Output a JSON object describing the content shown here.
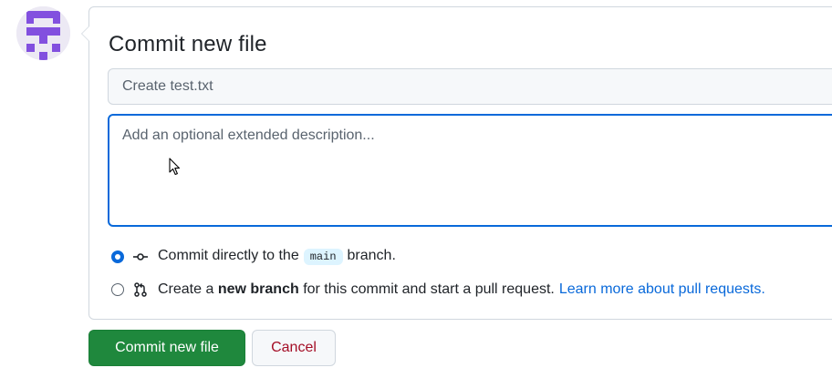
{
  "form": {
    "title": "Commit new file",
    "summary_value": "",
    "summary_placeholder": "Create test.txt",
    "description_value": "",
    "description_placeholder": "Add an optional extended description..."
  },
  "options": {
    "direct": {
      "selected": true,
      "text_before": "Commit directly to the",
      "branch": "main",
      "text_after": "branch."
    },
    "new_branch": {
      "selected": false,
      "text_before": "Create a",
      "bold": "new branch",
      "text_after": "for this commit and start a pull request.",
      "link": "Learn more about pull requests."
    }
  },
  "actions": {
    "commit_label": "Commit new file",
    "cancel_label": "Cancel"
  },
  "colors": {
    "accent": "#0969da",
    "commit_button": "#1f883d",
    "cancel_text": "#a40e26",
    "avatar": "#8250df"
  },
  "icons": {
    "avatar": "identicon-avatar",
    "direct": "git-commit-icon",
    "new_branch": "git-pull-request-icon",
    "cursor": "mouse-pointer-icon"
  }
}
